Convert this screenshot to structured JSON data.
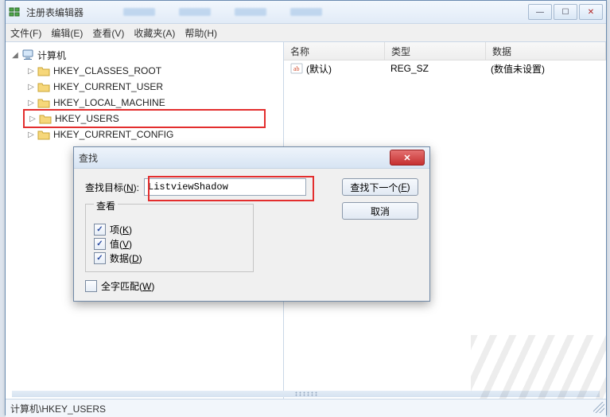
{
  "titlebar": {
    "title": "注册表编辑器"
  },
  "win_controls": {
    "min": "—",
    "max": "☐",
    "close": "✕"
  },
  "menubar": {
    "file": "文件(F)",
    "edit": "编辑(E)",
    "view": "查看(V)",
    "favorites": "收藏夹(A)",
    "help": "帮助(H)"
  },
  "tree": {
    "root": "计算机",
    "items": [
      "HKEY_CLASSES_ROOT",
      "HKEY_CURRENT_USER",
      "HKEY_LOCAL_MACHINE",
      "HKEY_USERS",
      "HKEY_CURRENT_CONFIG"
    ]
  },
  "list": {
    "headers": {
      "name": "名称",
      "type": "类型",
      "data": "数据"
    },
    "row0": {
      "name": "(默认)",
      "type": "REG_SZ",
      "data": "(数值未设置)"
    }
  },
  "statusbar": {
    "path": "计算机\\HKEY_USERS"
  },
  "find_dialog": {
    "title": "查找",
    "label_prefix": "查找目标(",
    "label_mn": "N",
    "label_suffix": "):",
    "value": "ListviewShadow",
    "btn_next_prefix": "查找下一个(",
    "btn_next_mn": "F",
    "btn_next_suffix": ")",
    "btn_cancel": "取消",
    "legend": "查看",
    "chk_keys_prefix": "项(",
    "chk_keys_mn": "K",
    "chk_keys_suffix": ")",
    "chk_values_prefix": "值(",
    "chk_values_mn": "V",
    "chk_values_suffix": ")",
    "chk_data_prefix": "数据(",
    "chk_data_mn": "D",
    "chk_data_suffix": ")",
    "chk_whole_prefix": "全字匹配(",
    "chk_whole_mn": "W",
    "chk_whole_suffix": ")",
    "close_glyph": "✕"
  }
}
